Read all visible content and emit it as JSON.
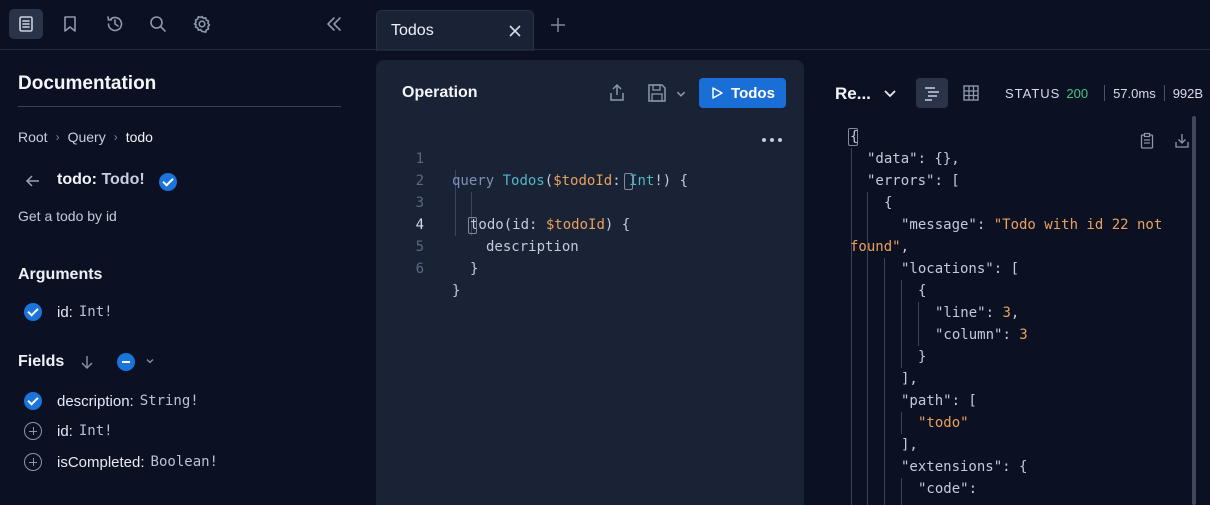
{
  "tab": {
    "label": "Todos"
  },
  "toolbar": {
    "icons": [
      "docs-icon",
      "bookmark-icon",
      "history-icon",
      "search-icon",
      "gear-icon",
      "collapse-icon"
    ]
  },
  "docs": {
    "title": "Documentation",
    "breadcrumb": [
      "Root",
      "Query",
      "todo"
    ],
    "field_name": "todo:",
    "field_type": "Todo!",
    "description": "Get a todo by id",
    "arguments_title": "Arguments",
    "arguments": [
      {
        "name": "id:",
        "type": "Int!",
        "checked": true
      }
    ],
    "fields_title": "Fields",
    "fields": [
      {
        "name": "description:",
        "type": "String!",
        "checked": true
      },
      {
        "name": "id:",
        "type": "Int!",
        "checked": false
      },
      {
        "name": "isCompleted:",
        "type": "Boolean!",
        "checked": false
      }
    ]
  },
  "operation": {
    "title": "Operation",
    "run_label": "Todos",
    "lines": [
      {
        "num": "1",
        "parts": [
          "query",
          "Todos",
          "(",
          "$todoId",
          ": ",
          "Int",
          "!) {"
        ]
      },
      {
        "num": "2"
      },
      {
        "num": "3",
        "parts": [
          "todo",
          "(id: ",
          "$todoId",
          ") {"
        ]
      },
      {
        "num": "4",
        "parts": [
          "description"
        ]
      },
      {
        "num": "5",
        "parts": [
          "}"
        ]
      },
      {
        "num": "6",
        "parts": [
          "}"
        ]
      }
    ]
  },
  "response": {
    "title": "Re...",
    "status_label": "STATUS",
    "status_code": "200",
    "time": "57.0ms",
    "size": "992B",
    "lines": [
      "{",
      "\"data\": {},",
      "\"errors\": [",
      "{",
      "\"message\": \"Todo with id 22 not",
      "found\",",
      "\"locations\": [",
      "{",
      "\"line\": 3,",
      "\"column\": 3",
      "}",
      "],",
      "\"path\": [",
      "\"todo\"",
      "],",
      "\"extensions\": {",
      "\"code\":"
    ]
  },
  "colors": {
    "accent": "#1a6fd6",
    "success": "#4cc38a",
    "string": "#e8a15d",
    "type": "#4fb8c2"
  }
}
